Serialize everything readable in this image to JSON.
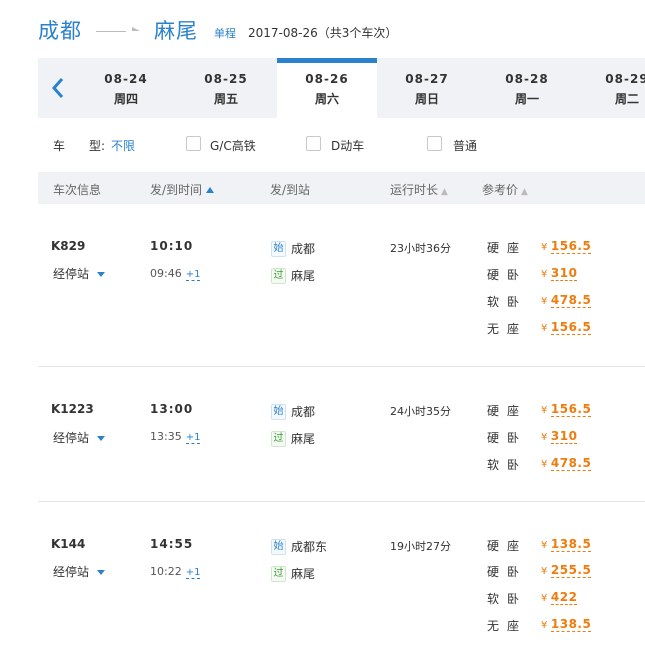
{
  "route": {
    "from": "成都",
    "to": "麻尾",
    "trip_type": "单程",
    "summary": "2017-08-26（共3个车次）"
  },
  "dates": [
    {
      "date": "08-24",
      "weekday": "周四"
    },
    {
      "date": "08-25",
      "weekday": "周五"
    },
    {
      "date": "08-26",
      "weekday": "周六",
      "active": true
    },
    {
      "date": "08-27",
      "weekday": "周日"
    },
    {
      "date": "08-28",
      "weekday": "周一"
    },
    {
      "date": "08-29",
      "weekday": "周二"
    }
  ],
  "date_back_icon": "chevron-left-icon",
  "filter": {
    "label": "车　　型:",
    "value": "不限",
    "options": [
      "G/C高铁",
      "D动车",
      "普通"
    ]
  },
  "table_header": {
    "train_info": "车次信息",
    "time": "发/到时间",
    "station": "发/到站",
    "duration": "运行时长",
    "price": "参考价"
  },
  "trains": [
    {
      "no": "K829",
      "stops_label": "经停站",
      "dep_time": "10:10",
      "arr_time": "09:46",
      "day_offset": "+1",
      "dep_badge": "始",
      "dep_station": "成都",
      "arr_badge": "过",
      "arr_station": "麻尾",
      "duration": "23小时36分",
      "seats": [
        {
          "type": "硬座",
          "currency": "¥",
          "price": "156.5"
        },
        {
          "type": "硬卧",
          "currency": "¥",
          "price": "310"
        },
        {
          "type": "软卧",
          "currency": "¥",
          "price": "478.5"
        },
        {
          "type": "无座",
          "currency": "¥",
          "price": "156.5"
        }
      ]
    },
    {
      "no": "K1223",
      "stops_label": "经停站",
      "dep_time": "13:00",
      "arr_time": "13:35",
      "day_offset": "+1",
      "dep_badge": "始",
      "dep_station": "成都",
      "arr_badge": "过",
      "arr_station": "麻尾",
      "duration": "24小时35分",
      "seats": [
        {
          "type": "硬座",
          "currency": "¥",
          "price": "156.5"
        },
        {
          "type": "硬卧",
          "currency": "¥",
          "price": "310"
        },
        {
          "type": "软卧",
          "currency": "¥",
          "price": "478.5"
        }
      ]
    },
    {
      "no": "K144",
      "stops_label": "经停站",
      "dep_time": "14:55",
      "arr_time": "10:22",
      "day_offset": "+1",
      "dep_badge": "始",
      "dep_station": "成都东",
      "arr_badge": "过",
      "arr_station": "麻尾",
      "duration": "19小时27分",
      "seats": [
        {
          "type": "硬座",
          "currency": "¥",
          "price": "138.5"
        },
        {
          "type": "硬卧",
          "currency": "¥",
          "price": "255.5"
        },
        {
          "type": "软卧",
          "currency": "¥",
          "price": "422"
        },
        {
          "type": "无座",
          "currency": "¥",
          "price": "138.5"
        }
      ]
    }
  ],
  "colors": {
    "accent": "#2b82cc",
    "price": "#ef7c0e",
    "bar_bg": "#f0f2f5"
  }
}
